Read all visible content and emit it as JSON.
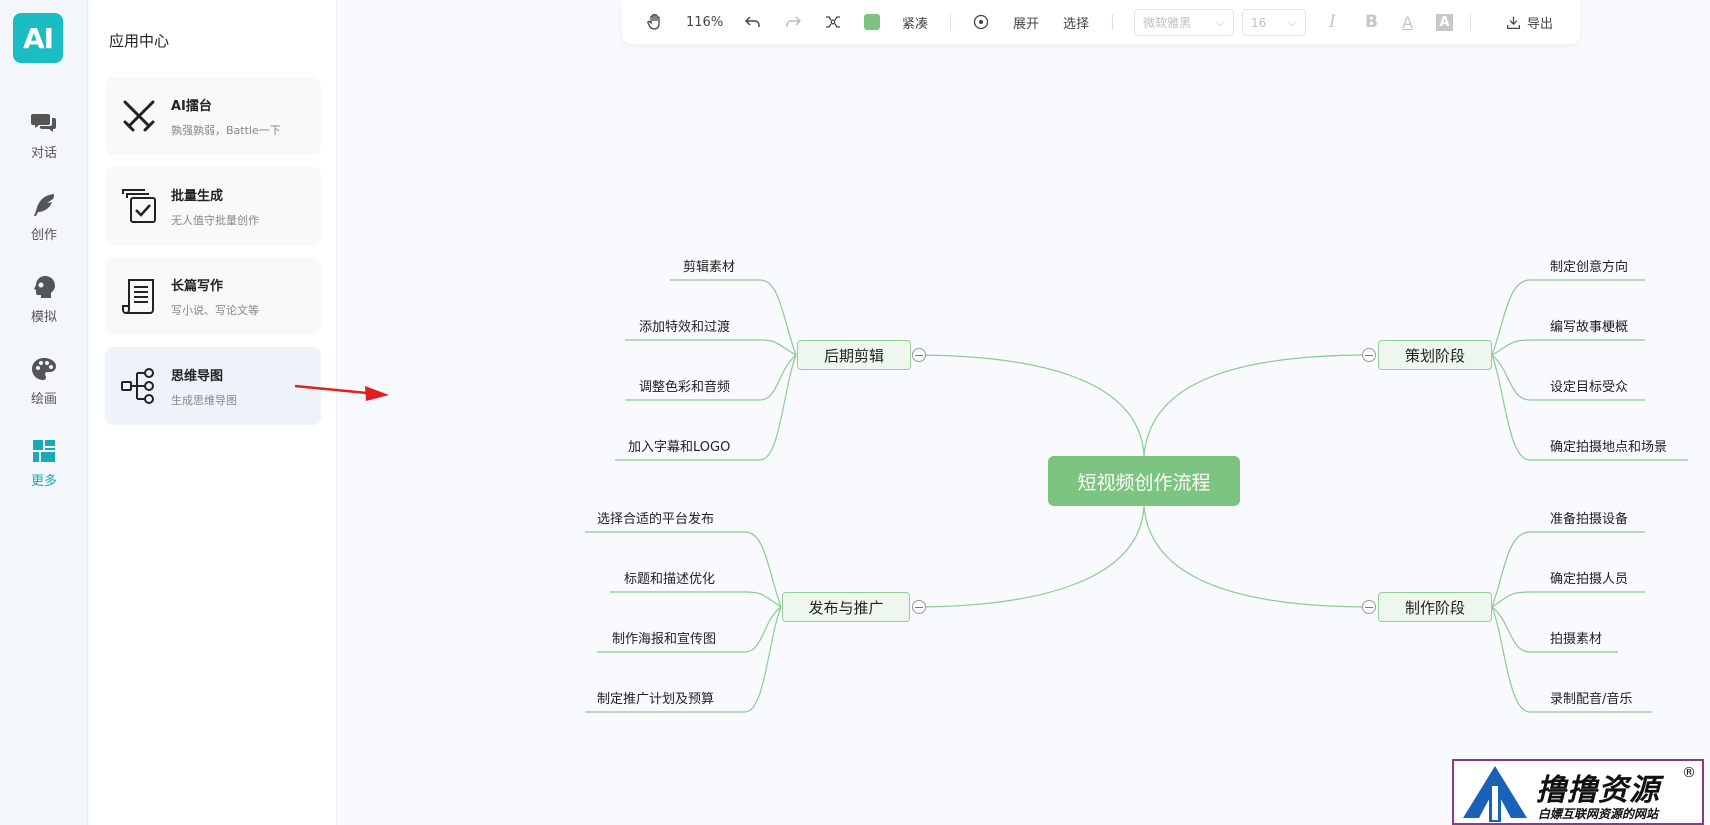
{
  "app": {
    "logo_text": "AI"
  },
  "rail": {
    "items": [
      {
        "label": "对话",
        "icon": "chat-icon"
      },
      {
        "label": "创作",
        "icon": "feather-icon"
      },
      {
        "label": "模拟",
        "icon": "head-profile-icon"
      },
      {
        "label": "绘画",
        "icon": "palette-icon"
      },
      {
        "label": "更多",
        "icon": "grid-icon",
        "active": true
      }
    ],
    "active_color": "#1aa9b7"
  },
  "panel": {
    "title": "应用中心",
    "cards": [
      {
        "title": "AI擂台",
        "subtitle": "孰强孰弱，Battle一下",
        "icon": "crossed-swords-icon"
      },
      {
        "title": "批量生成",
        "subtitle": "无人值守批量创作",
        "icon": "stacked-check-icon"
      },
      {
        "title": "长篇写作",
        "subtitle": "写小说、写论文等",
        "icon": "scroll-icon"
      },
      {
        "title": "思维导图",
        "subtitle": "生成思维导图",
        "icon": "mindmap-icon",
        "selected": true
      }
    ]
  },
  "toolbar": {
    "zoom": "116%",
    "layout_label": "紧凑",
    "expand_label": "展开",
    "select_label": "选择",
    "font_family": "微软雅黑",
    "font_size": "16",
    "export_label": "导出",
    "swatch_color": "#7cc47f"
  },
  "mindmap": {
    "root": "短视频创作流程",
    "branches": {
      "planning": {
        "label": "策划阶段",
        "children": [
          "制定创意方向",
          "编写故事梗概",
          "设定目标受众",
          "确定拍摄地点和场景"
        ]
      },
      "production": {
        "label": "制作阶段",
        "children": [
          "准备拍摄设备",
          "确定拍摄人员",
          "拍摄素材",
          "录制配音/音乐"
        ]
      },
      "post": {
        "label": "后期剪辑",
        "children": [
          "剪辑素材",
          "添加特效和过渡",
          "调整色彩和音频",
          "加入字幕和LOGO"
        ]
      },
      "publish": {
        "label": "发布与推广",
        "children": [
          "选择合适的平台发布",
          "标题和描述优化",
          "制作海报和宣传图",
          "制定推广计划及预算"
        ]
      }
    },
    "line_color": "#8ccb8f"
  },
  "watermark": {
    "main": "撸撸资源",
    "sub": "白嫖互联网资源的网站",
    "reg": "®"
  }
}
